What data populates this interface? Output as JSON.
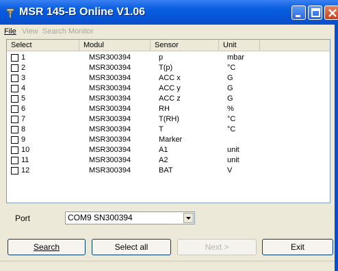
{
  "window": {
    "title": "MSR 145-B Online V1.06"
  },
  "menu": [
    {
      "label": "File",
      "enabled": true
    },
    {
      "label": "View",
      "enabled": false
    },
    {
      "label": "Search",
      "enabled": false
    },
    {
      "label": "Monitor",
      "enabled": false
    }
  ],
  "table": {
    "columns": [
      "Select",
      "Modul",
      "Sensor",
      "Unit"
    ],
    "rows": [
      {
        "select": "1",
        "modul": "MSR300394",
        "sensor": "p",
        "unit": "mbar"
      },
      {
        "select": "2",
        "modul": "MSR300394",
        "sensor": "T(p)",
        "unit": "°C"
      },
      {
        "select": "3",
        "modul": "MSR300394",
        "sensor": "ACC x",
        "unit": "G"
      },
      {
        "select": "4",
        "modul": "MSR300394",
        "sensor": "ACC y",
        "unit": "G"
      },
      {
        "select": "5",
        "modul": "MSR300394",
        "sensor": "ACC z",
        "unit": "G"
      },
      {
        "select": "6",
        "modul": "MSR300394",
        "sensor": "RH",
        "unit": "%"
      },
      {
        "select": "7",
        "modul": "MSR300394",
        "sensor": "T(RH)",
        "unit": "°C"
      },
      {
        "select": "8",
        "modul": "MSR300394",
        "sensor": "T",
        "unit": "°C"
      },
      {
        "select": "9",
        "modul": "MSR300394",
        "sensor": "Marker",
        "unit": ""
      },
      {
        "select": "10",
        "modul": "MSR300394",
        "sensor": "A1",
        "unit": "unit"
      },
      {
        "select": "11",
        "modul": "MSR300394",
        "sensor": "A2",
        "unit": "unit"
      },
      {
        "select": "12",
        "modul": "MSR300394",
        "sensor": "BAT",
        "unit": "V"
      }
    ]
  },
  "port": {
    "label": "Port",
    "value": "COM9 SN300394"
  },
  "buttons": {
    "search": "Search",
    "select_all": "Select all",
    "next": "Next >",
    "exit": "Exit"
  },
  "colors": {
    "titlebar": "#0554d6",
    "window_bg": "#ece9d8",
    "close_button": "#c4401e"
  },
  "icons": {
    "app": "plug-icon",
    "minimize": "minimize-icon",
    "maximize": "maximize-icon",
    "close": "close-icon",
    "dropdown": "chevron-down-icon"
  }
}
